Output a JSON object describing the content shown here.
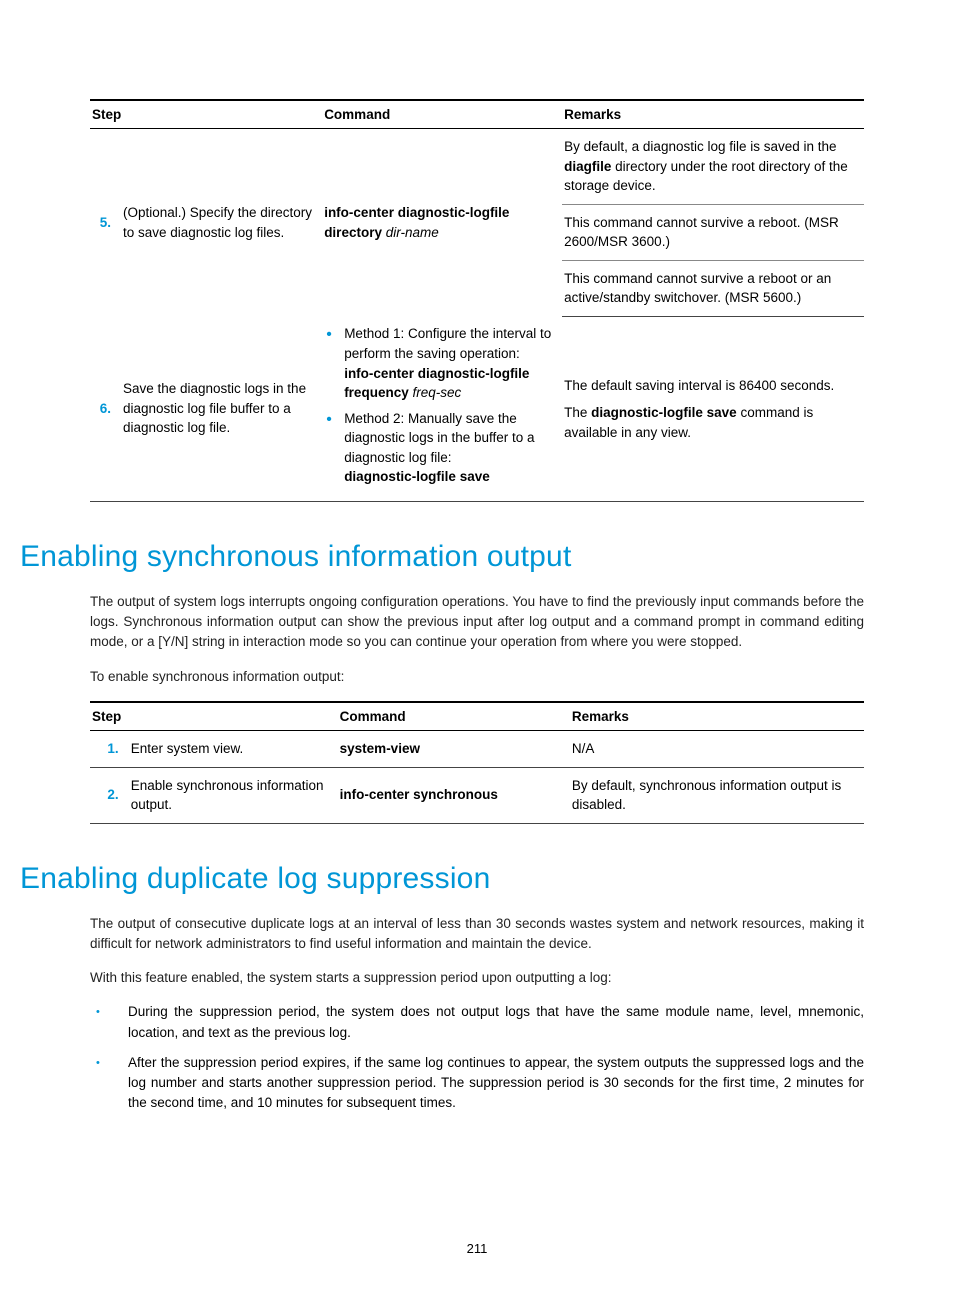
{
  "table1": {
    "headers": {
      "step": "Step",
      "command": "Command",
      "remarks": "Remarks"
    },
    "rows": [
      {
        "num": "5.",
        "desc": "(Optional.) Specify the directory to save diagnostic log files.",
        "cmd_bold": "info-center diagnostic-logfile directory",
        "cmd_ital": "dir-name",
        "remarks": [
          {
            "pre": "By default, a diagnostic log file is saved in the ",
            "bold": "diagfile",
            "post": " directory under the root directory of the storage device."
          },
          {
            "pre": "This command cannot survive a reboot. (MSR 2600/MSR 3600.)",
            "bold": "",
            "post": ""
          },
          {
            "pre": "This command cannot survive a reboot or an active/standby switchover. (MSR 5600.)",
            "bold": "",
            "post": ""
          }
        ]
      },
      {
        "num": "6.",
        "desc": "Save the diagnostic logs in the diagnostic log file buffer to a diagnostic log file.",
        "methods": [
          {
            "lead": "Method 1: Configure the interval to perform the saving operation:",
            "cmd_bold": "info-center diagnostic-logfile frequency",
            "cmd_ital": "freq-sec"
          },
          {
            "lead": "Method 2: Manually save the diagnostic logs in the buffer to a diagnostic log file:",
            "cmd_bold": "diagnostic-logfile save",
            "cmd_ital": ""
          }
        ],
        "remark_a": "The default saving interval is 86400 seconds.",
        "remark_b_pre": "The ",
        "remark_b_bold": "diagnostic-logfile save",
        "remark_b_post": " command is available in any view."
      }
    ]
  },
  "section1": {
    "heading": "Enabling synchronous information output",
    "para1": "The output of system logs interrupts ongoing configuration operations. You have to find the previously input commands before the logs. Synchronous information output can show the previous input after log output and a command prompt in command editing mode, or a [Y/N] string in interaction mode so you can continue your operation from where you were stopped.",
    "para2": "To enable synchronous information output:"
  },
  "table2": {
    "headers": {
      "step": "Step",
      "command": "Command",
      "remarks": "Remarks"
    },
    "rows": [
      {
        "num": "1.",
        "desc": "Enter system view.",
        "cmd": "system-view",
        "rem": "N/A"
      },
      {
        "num": "2.",
        "desc": "Enable synchronous information output.",
        "cmd": "info-center synchronous",
        "rem": "By default, synchronous information output is disabled."
      }
    ]
  },
  "section2": {
    "heading": "Enabling duplicate log suppression",
    "para1": "The output of consecutive duplicate logs at an interval of less than 30 seconds wastes system and network resources, making it difficult for network administrators to find useful information and maintain the device.",
    "para2": "With this feature enabled, the system starts a suppression period upon outputting a log:",
    "bullets": [
      "During the suppression period, the system does not output logs that have the same module name, level, mnemonic, location, and text as the previous log.",
      "After the suppression period expires, if the same log continues to appear, the system outputs the suppressed logs and the log number and starts another suppression period. The suppression period is 30 seconds for the first time, 2 minutes for the second time, and 10 minutes for subsequent times."
    ]
  },
  "page_number": "211"
}
